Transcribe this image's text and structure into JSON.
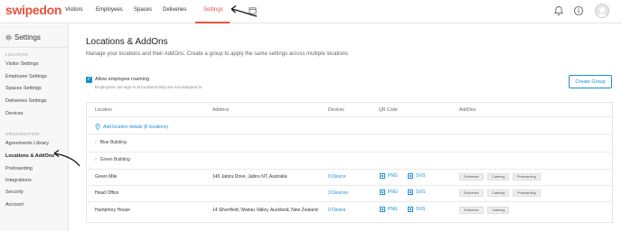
{
  "app": {
    "logo": "swipedon"
  },
  "nav": {
    "items": [
      {
        "label": "Visitors"
      },
      {
        "label": "Employees"
      },
      {
        "label": "Spaces"
      },
      {
        "label": "Deliveries"
      },
      {
        "label": "Settings",
        "active": true
      }
    ],
    "icons": [
      "bell-icon",
      "help-icon",
      "avatar"
    ]
  },
  "sidebar": {
    "title": "Settings",
    "location_heading": "LOCATION",
    "location_items": [
      "Visitor Settings",
      "Employee Settings",
      "Spaces Settings",
      "Deliveries Settings",
      "Devices"
    ],
    "org_heading": "ORGANIZATION",
    "org_items": [
      "Agreements Library",
      "Locations & AddOns",
      "Preboarding",
      "Integrations",
      "Security",
      "Account"
    ]
  },
  "main": {
    "title": "Locations & AddOns",
    "subtitle": "Manage your locations and their AddOns. Create a group to apply the same settings across multiple locations",
    "roaming": {
      "checked": true,
      "label": "Allow employee roaming",
      "description": "Employees can sign in at locations they are not assigned to"
    },
    "create_group_label": "Create Group",
    "table": {
      "headers": [
        "Location",
        "Address",
        "Devices",
        "QR Code",
        "AddOns"
      ],
      "add_location_label": "Add location details (8 locations)",
      "groups": [
        "Blue Building",
        "Green Building"
      ],
      "rows": [
        {
          "name": "Green Mile",
          "address": "145 Jabiru Drive, Jabiru NT, Australia",
          "devices": "0 Device",
          "qr": [
            "PNG",
            "SVG"
          ],
          "addons": [
            "Deliveries",
            "Catering",
            "Preboarding"
          ]
        },
        {
          "name": "Head Office",
          "address": "",
          "devices": "3 Devices",
          "qr": [
            "PNG",
            "SVG"
          ],
          "addons": [
            "Deliveries",
            "Catering",
            "Preboarding"
          ]
        },
        {
          "name": "Humphrey House",
          "address": "14 Silverfield, Wairau Valley, Auckland, New Zealand",
          "devices": "0 Device",
          "qr": [
            "PNG",
            "SVG"
          ],
          "addons": [
            "Deliveries",
            "Catering"
          ]
        }
      ]
    }
  },
  "colors": {
    "brand": "#e5533d",
    "link": "#1a8fd6",
    "annotation": "#111111"
  }
}
